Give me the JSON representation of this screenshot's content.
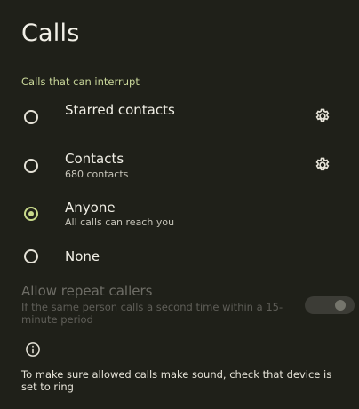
{
  "page": {
    "title": "Calls",
    "section_header": "Calls that can interrupt"
  },
  "options": [
    {
      "title": "Starred contacts",
      "subtitle": "",
      "selected": false,
      "has_settings": true
    },
    {
      "title": "Contacts",
      "subtitle": "680 contacts",
      "selected": false,
      "has_settings": true
    },
    {
      "title": "Anyone",
      "subtitle": "All calls can reach you",
      "selected": true,
      "has_settings": false
    },
    {
      "title": "None",
      "subtitle": "",
      "selected": false,
      "has_settings": false
    }
  ],
  "repeat_callers": {
    "title": "Allow repeat callers",
    "subtitle": "If the same person calls a second time within a 15-minute period",
    "enabled": false,
    "toggle_on": false
  },
  "footer": {
    "info_icon": "info-icon",
    "text": "To make sure allowed calls make sound, check that device is set to ring"
  },
  "colors": {
    "background": "#1f2019",
    "accent": "#c8d98b",
    "section_header": "#c9d79a"
  }
}
